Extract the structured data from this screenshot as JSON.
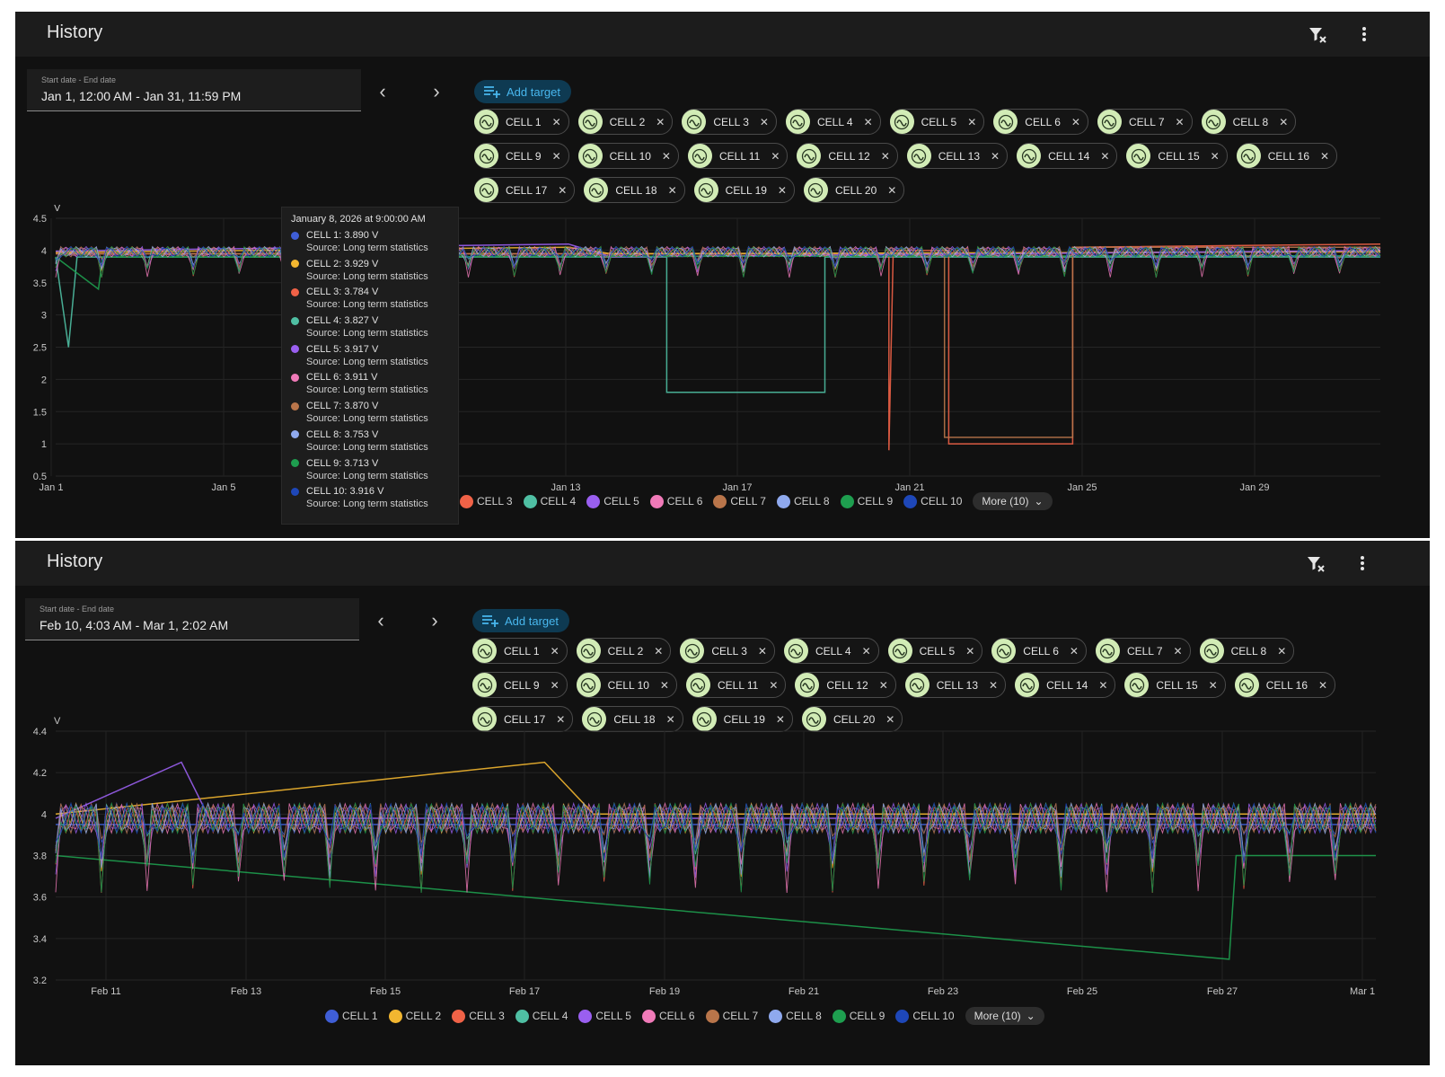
{
  "colors": {
    "cell1": "#3f5ed6",
    "cell2": "#f2b630",
    "cell3": "#f06247",
    "cell4": "#4fbfa3",
    "cell5": "#9a5ff0",
    "cell6": "#f07ab8",
    "cell7": "#b9754a",
    "cell8": "#8fa9ee",
    "cell9": "#1e9e4f",
    "cell10": "#1e47b8",
    "chip_bg": "#d2ecb6",
    "accent": "#48b7ee"
  },
  "panels": [
    {
      "title": "History",
      "date_label": "Start date - End date",
      "date_value": "Jan 1, 12:00 AM - Jan 31, 11:59 PM",
      "add_target": "Add target",
      "filter_icon": "filter-clear-icon",
      "menu_icon": "more-vert-icon",
      "chips": [
        "CELL 1",
        "CELL 2",
        "CELL 3",
        "CELL 4",
        "CELL 5",
        "CELL 6",
        "CELL 7",
        "CELL 8",
        "CELL 9",
        "CELL 10",
        "CELL 11",
        "CELL 12",
        "CELL 13",
        "CELL 14",
        "CELL 15",
        "CELL 16",
        "CELL 17",
        "CELL 18",
        "CELL 19",
        "CELL 20"
      ],
      "legend": [
        "CELL 3",
        "CELL 4",
        "CELL 5",
        "CELL 6",
        "CELL 7",
        "CELL 8",
        "CELL 9",
        "CELL 10"
      ],
      "more": "More (10)",
      "tooltip": {
        "title": "January 8, 2026 at 9:00:00 AM",
        "entries": [
          {
            "label": "CELL 1: 3.890 V",
            "source": "Source: Long term statistics"
          },
          {
            "label": "CELL 2: 3.929 V",
            "source": "Source: Long term statistics"
          },
          {
            "label": "CELL 3: 3.784 V",
            "source": "Source: Long term statistics"
          },
          {
            "label": "CELL 4: 3.827 V",
            "source": "Source: Long term statistics"
          },
          {
            "label": "CELL 5: 3.917 V",
            "source": "Source: Long term statistics"
          },
          {
            "label": "CELL 6: 3.911 V",
            "source": "Source: Long term statistics"
          },
          {
            "label": "CELL 7: 3.870 V",
            "source": "Source: Long term statistics"
          },
          {
            "label": "CELL 8: 3.753 V",
            "source": "Source: Long term statistics"
          },
          {
            "label": "CELL 9: 3.713 V",
            "source": "Source: Long term statistics"
          },
          {
            "label": "CELL 10: 3.916 V",
            "source": "Source: Long term statistics"
          }
        ]
      }
    },
    {
      "title": "History",
      "date_label": "Start date - End date",
      "date_value": "Feb 10, 4:03 AM - Mar 1, 2:02 AM",
      "add_target": "Add target",
      "filter_icon": "filter-clear-icon",
      "menu_icon": "more-vert-icon",
      "chips": [
        "CELL 1",
        "CELL 2",
        "CELL 3",
        "CELL 4",
        "CELL 5",
        "CELL 6",
        "CELL 7",
        "CELL 8",
        "CELL 9",
        "CELL 10",
        "CELL 11",
        "CELL 12",
        "CELL 13",
        "CELL 14",
        "CELL 15",
        "CELL 16",
        "CELL 17",
        "CELL 18",
        "CELL 19",
        "CELL 20"
      ],
      "legend": [
        "CELL 1",
        "CELL 2",
        "CELL 3",
        "CELL 4",
        "CELL 5",
        "CELL 6",
        "CELL 7",
        "CELL 8",
        "CELL 9",
        "CELL 10"
      ],
      "more": "More (10)"
    }
  ],
  "chart_data": [
    {
      "type": "line",
      "ylabel": "V",
      "yticks": [
        "4.5",
        "4",
        "3.5",
        "3",
        "2.5",
        "2",
        "1.5",
        "1",
        "0.5"
      ],
      "ylim": [
        0.5,
        4.5
      ],
      "xticks": [
        "Jan 1",
        "Jan 5",
        "Jan 13",
        "Jan 17",
        "Jan 21",
        "Jan 25",
        "Jan 29"
      ],
      "x_range_days": [
        1,
        32
      ],
      "series": [
        {
          "name": "CELL 4",
          "points": [
            [
              1,
              3.9
            ],
            [
              1.3,
              2.5
            ],
            [
              1.5,
              3.9
            ],
            [
              15.3,
              3.9
            ],
            [
              15.3,
              1.8
            ],
            [
              19,
              1.8
            ],
            [
              19,
              3.9
            ],
            [
              32,
              3.9
            ]
          ]
        },
        {
          "name": "CELL 3",
          "points": [
            [
              1,
              3.95
            ],
            [
              20.5,
              3.95
            ],
            [
              20.5,
              0.9
            ],
            [
              20.6,
              4.0
            ],
            [
              21.9,
              4.0
            ],
            [
              21.9,
              1.0
            ],
            [
              24.8,
              1.0
            ],
            [
              24.8,
              4.05
            ],
            [
              32,
              4.1
            ]
          ]
        },
        {
          "name": "CELL 7",
          "points": [
            [
              1,
              3.95
            ],
            [
              21.8,
              3.95
            ],
            [
              21.8,
              1.1
            ],
            [
              24.8,
              1.1
            ],
            [
              24.8,
              4.05
            ],
            [
              32,
              4.05
            ]
          ]
        },
        {
          "name": "CELL 2",
          "points": [
            [
              1,
              3.97
            ],
            [
              13,
              4.05
            ],
            [
              14,
              3.95
            ],
            [
              32,
              3.98
            ]
          ]
        },
        {
          "name": "CELL 5",
          "points": [
            [
              1,
              3.99
            ],
            [
              13,
              4.1
            ],
            [
              14,
              3.9
            ],
            [
              32,
              4.0
            ]
          ]
        },
        {
          "name": "CELL 9",
          "points": [
            [
              1,
              3.9
            ],
            [
              2,
              3.4
            ],
            [
              2.1,
              3.9
            ],
            [
              32,
              3.92
            ]
          ]
        }
      ]
    },
    {
      "type": "line",
      "ylabel": "V",
      "yticks": [
        "4.4",
        "4.2",
        "4",
        "3.8",
        "3.6",
        "3.4",
        "3.2"
      ],
      "ylim": [
        3.2,
        4.4
      ],
      "xticks": [
        "Feb 11",
        "Feb 13",
        "Feb 15",
        "Feb 17",
        "Feb 19",
        "Feb 21",
        "Feb 23",
        "Feb 25",
        "Feb 27",
        "Mar 1"
      ],
      "x_range_days": [
        10.2,
        29.1
      ],
      "series": [
        {
          "name": "CELL 1",
          "points": [
            [
              10.2,
              3.95
            ],
            [
              29.1,
              3.95
            ]
          ]
        },
        {
          "name": "CELL 2",
          "points": [
            [
              10.2,
              4.0
            ],
            [
              17.2,
              4.25
            ],
            [
              17.9,
              4.0
            ],
            [
              29.1,
              4.0
            ]
          ]
        },
        {
          "name": "CELL 5",
          "points": [
            [
              10.2,
              3.98
            ],
            [
              12,
              4.25
            ],
            [
              12.4,
              3.98
            ],
            [
              29.1,
              3.98
            ]
          ]
        },
        {
          "name": "CELL 9",
          "points": [
            [
              10.2,
              3.8
            ],
            [
              27,
              3.3
            ],
            [
              27.1,
              3.8
            ],
            [
              29.1,
              3.8
            ]
          ]
        }
      ]
    }
  ]
}
